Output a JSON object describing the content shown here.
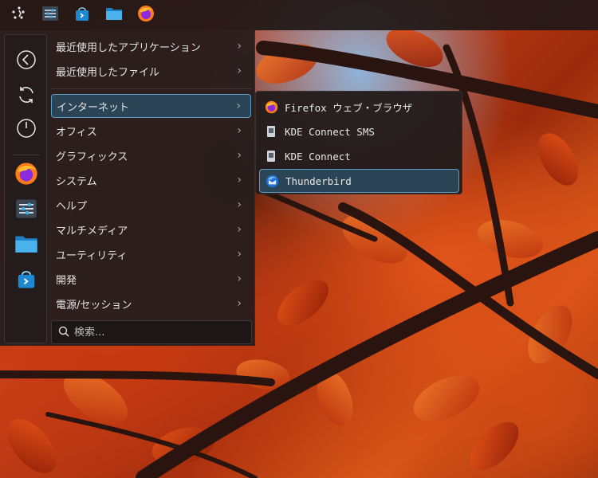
{
  "taskbar": {
    "items": [
      {
        "name": "application-launcher",
        "icon": "launcher-icon"
      },
      {
        "name": "system-settings",
        "icon": "settings-sliders-icon"
      },
      {
        "name": "discover",
        "icon": "store-bag-icon"
      },
      {
        "name": "dolphin",
        "icon": "folder-icon"
      },
      {
        "name": "firefox",
        "icon": "firefox-icon"
      }
    ]
  },
  "sidebar": {
    "buttons": [
      {
        "icon": "back-arrow-icon"
      },
      {
        "icon": "refresh-icon"
      },
      {
        "icon": "power-icon"
      },
      {
        "icon": "firefox-icon"
      },
      {
        "icon": "settings-sliders-icon"
      },
      {
        "icon": "folder-icon"
      },
      {
        "icon": "store-bag-icon"
      }
    ]
  },
  "menu": {
    "recent_apps": "最近使用したアプリケーション",
    "recent_files": "最近使用したファイル",
    "categories": [
      "インターネット",
      "オフィス",
      "グラフィックス",
      "システム",
      "ヘルプ",
      "マルチメディア",
      "ユーティリティ",
      "開発",
      "電源/セッション"
    ],
    "selected_category": "インターネット"
  },
  "search": {
    "placeholder": "検索..."
  },
  "submenu": {
    "items": [
      {
        "label": "Firefox ウェブ・ブラウザ",
        "icon": "firefox-icon"
      },
      {
        "label": "KDE Connect SMS",
        "icon": "kdeconnect-sms-icon"
      },
      {
        "label": "KDE Connect",
        "icon": "kdeconnect-icon"
      },
      {
        "label": "Thunderbird",
        "icon": "thunderbird-icon"
      }
    ],
    "selected": "Thunderbird"
  },
  "colors": {
    "accent": "#5f9cc4",
    "selection_bg": "#2c4556",
    "menu_bg": "#281e1e"
  }
}
